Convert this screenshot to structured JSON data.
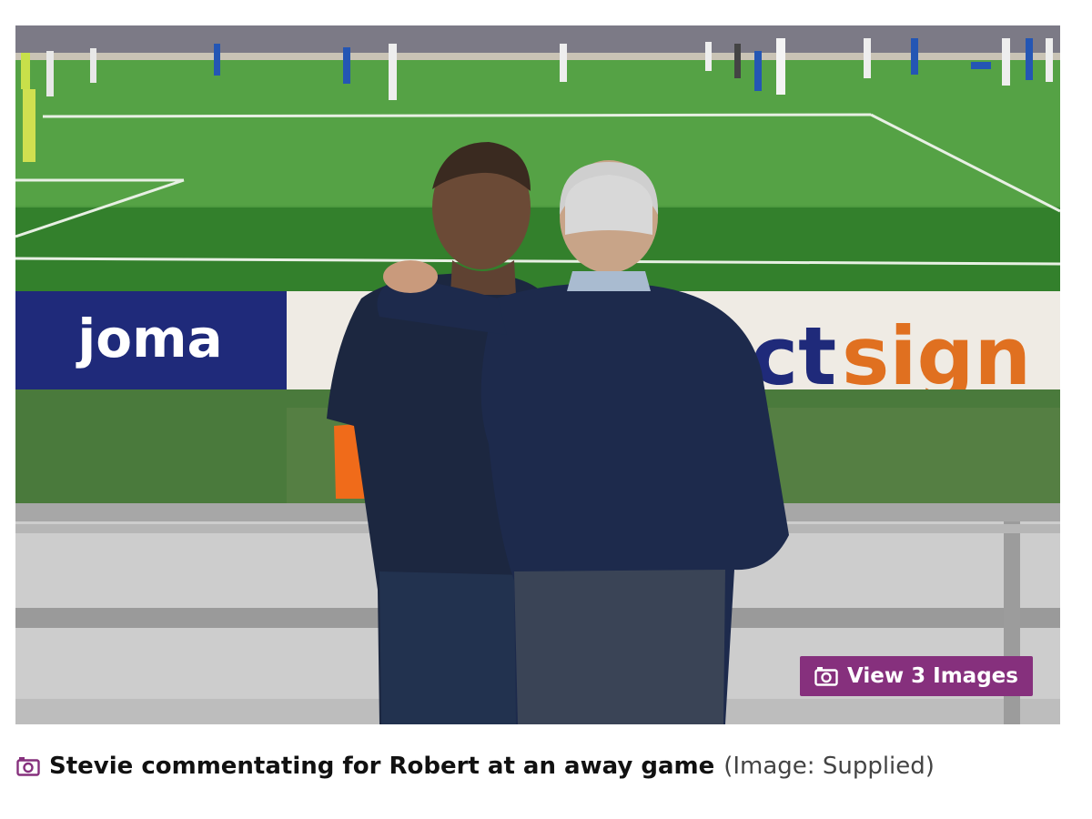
{
  "photo": {
    "board_left_text": "joma",
    "board_right_text_blue": "ct",
    "board_right_text_orange": "sign"
  },
  "gallery_button": {
    "label": "View 3 Images",
    "icon": "camera-icon"
  },
  "caption": {
    "icon": "camera-icon",
    "text": "Stevie commentating for Robert at an away game",
    "credit": "(Image: Supplied)"
  },
  "colors": {
    "accent": "#86307d",
    "pitch": "#3f8f35",
    "board_blue": "#1f2a7a",
    "board_orange": "#e07020"
  }
}
